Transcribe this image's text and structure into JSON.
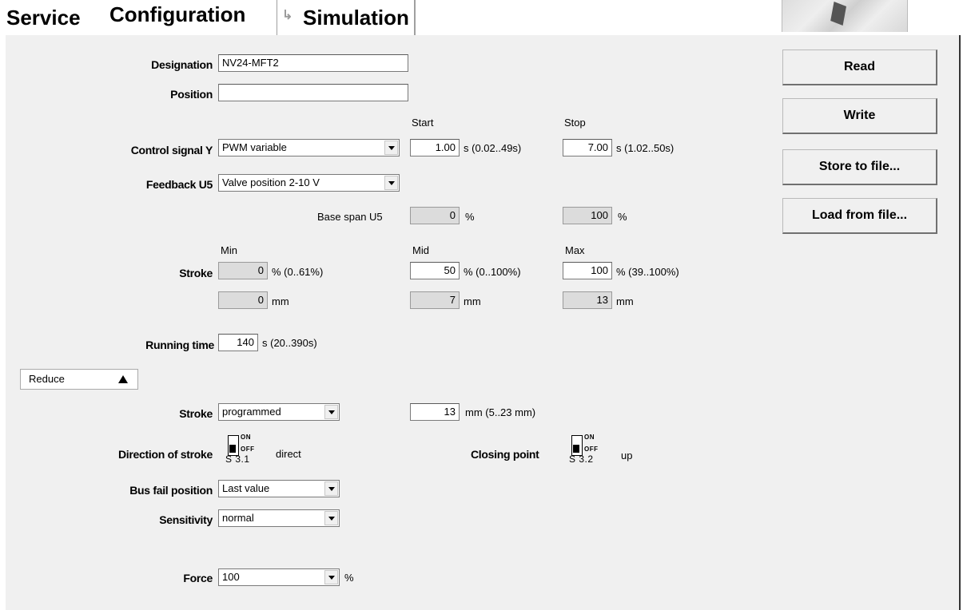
{
  "tabs": {
    "service": "Service",
    "configuration": "Configuration",
    "simulation": "Simulation"
  },
  "buttons": {
    "read": "Read",
    "write": "Write",
    "store": "Store to file...",
    "load": "Load from file..."
  },
  "designation": {
    "label": "Designation",
    "value": "NV24-MFT2"
  },
  "position": {
    "label": "Position",
    "value": ""
  },
  "control_signal": {
    "label": "Control signal Y",
    "value": "PWM variable",
    "start_header": "Start",
    "stop_header": "Stop",
    "start_value": "1.00",
    "start_range": "s (0.02..49s)",
    "stop_value": "7.00",
    "stop_range": "s (1.02..50s)"
  },
  "feedback": {
    "label": "Feedback U5",
    "value": "Valve position 2-10 V"
  },
  "base_span": {
    "label": "Base span U5",
    "min_value": "0",
    "min_unit": "%",
    "max_value": "100",
    "max_unit": "%"
  },
  "stroke": {
    "label": "Stroke",
    "min_header": "Min",
    "mid_header": "Mid",
    "max_header": "Max",
    "min_pct": "0",
    "min_pct_range": "% (0..61%)",
    "mid_pct": "50",
    "mid_pct_range": "% (0..100%)",
    "max_pct": "100",
    "max_pct_range": "% (39..100%)",
    "min_mm": "0",
    "mid_mm": "7",
    "max_mm": "13",
    "mm_unit": "mm"
  },
  "running_time": {
    "label": "Running time",
    "value": "140",
    "range": "s  (20..390s)"
  },
  "reduce": {
    "label": "Reduce"
  },
  "stroke2": {
    "label": "Stroke",
    "value": "programmed",
    "mm_value": "13",
    "mm_range": "mm (5..23 mm)"
  },
  "direction": {
    "label": "Direction of stroke",
    "switch_code": "S 3.1",
    "on": "ON",
    "off": "OFF",
    "state": "direct"
  },
  "closing": {
    "label": "Closing point",
    "switch_code": "S 3.2",
    "on": "ON",
    "off": "OFF",
    "state": "up"
  },
  "bus_fail": {
    "label": "Bus fail position",
    "value": "Last value"
  },
  "sensitivity": {
    "label": "Sensitivity",
    "value": "normal"
  },
  "force": {
    "label": "Force",
    "value": "100",
    "unit": "%"
  }
}
